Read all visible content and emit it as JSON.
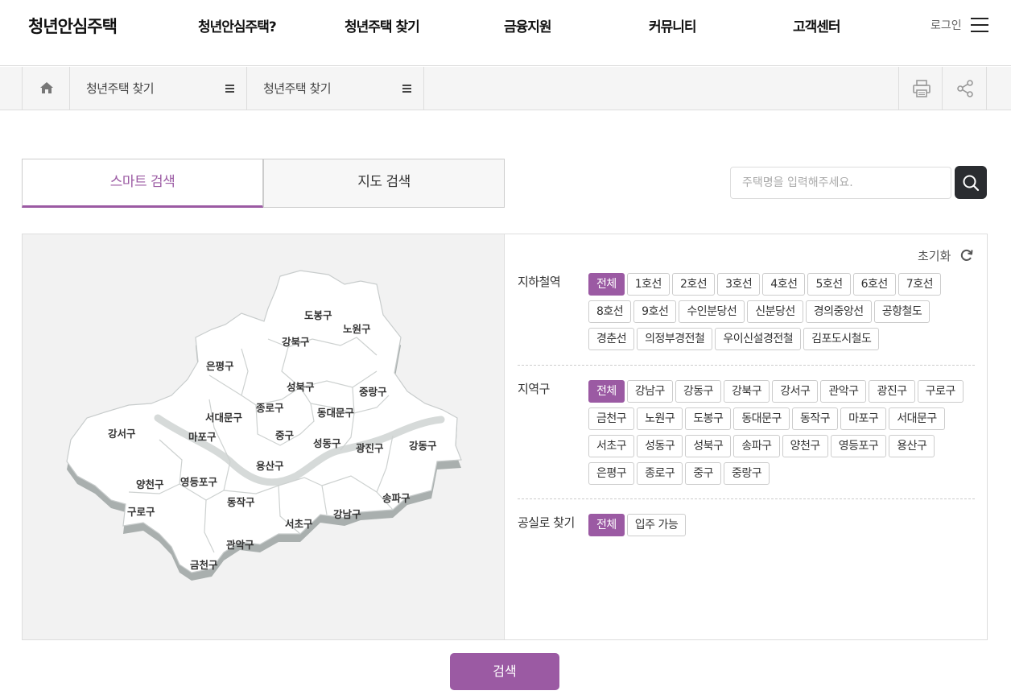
{
  "header": {
    "logo": "청년안심주택",
    "nav": [
      "청년안심주택?",
      "청년주택 찾기",
      "금융지원",
      "커뮤니티",
      "고객센터"
    ],
    "login": "로그인"
  },
  "breadcrumb": {
    "level1": "청년주택 찾기",
    "level2": "청년주택 찾기"
  },
  "tabs": {
    "smart": "스마트 검색",
    "map": "지도 검색"
  },
  "search": {
    "placeholder": "주택명을 입력해주세요."
  },
  "filters": {
    "reset_label": "초기화",
    "subway": {
      "label": "지하철역",
      "options": [
        "전체",
        "1호선",
        "2호선",
        "3호선",
        "4호선",
        "5호선",
        "6호선",
        "7호선",
        "8호선",
        "9호선",
        "수인분당선",
        "신분당선",
        "경의중앙선",
        "공항철도",
        "경춘선",
        "의정부경전철",
        "우이신설경전철",
        "김포도시철도"
      ],
      "selected": "전체"
    },
    "district": {
      "label": "지역구",
      "options": [
        "전체",
        "강남구",
        "강동구",
        "강북구",
        "강서구",
        "관악구",
        "광진구",
        "구로구",
        "금천구",
        "노원구",
        "도봉구",
        "동대문구",
        "동작구",
        "마포구",
        "서대문구",
        "서초구",
        "성동구",
        "성북구",
        "송파구",
        "양천구",
        "영등포구",
        "용산구",
        "은평구",
        "종로구",
        "중구",
        "중랑구"
      ],
      "selected": "전체"
    },
    "vacancy": {
      "label": "공실로 찾기",
      "options": [
        "전체",
        "입주 가능"
      ],
      "selected": "전체"
    }
  },
  "map": {
    "districts": {
      "dobong": "도봉구",
      "nowon": "노원구",
      "gangbuk": "강북구",
      "eunpyeong": "은평구",
      "seongbuk": "성북구",
      "jungnang": "중랑구",
      "jongno": "종로구",
      "seodaemun": "서대문구",
      "dongdaemun": "동대문구",
      "gangseo": "강서구",
      "mapo": "마포구",
      "jung": "중구",
      "seongdong": "성동구",
      "gwangjin": "광진구",
      "gangdong": "강동구",
      "yongsan": "용산구",
      "yangcheon": "양천구",
      "yeongdeungpo": "영등포구",
      "guro": "구로구",
      "dongjak": "동작구",
      "songpa": "송파구",
      "gangnam": "강남구",
      "seocho": "서초구",
      "gwanak": "관악구",
      "geumcheon": "금천구"
    }
  },
  "submit_label": "검색",
  "colors": {
    "accent": "#9b5aa3",
    "dark": "#2a2c30"
  }
}
